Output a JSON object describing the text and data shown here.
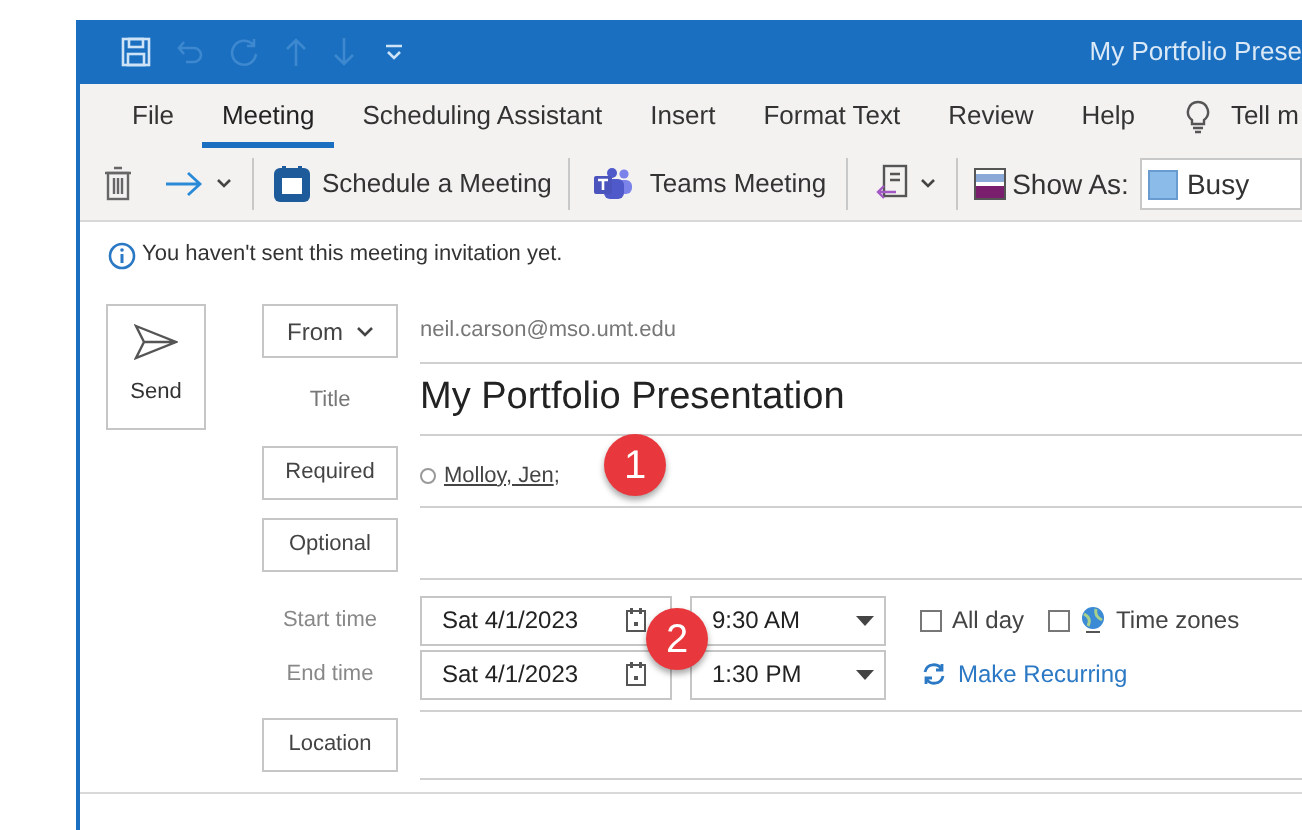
{
  "window": {
    "title": "My Portfolio Prese"
  },
  "tabs": [
    {
      "label": "File",
      "selected": false
    },
    {
      "label": "Meeting",
      "selected": true
    },
    {
      "label": "Scheduling Assistant",
      "selected": false
    },
    {
      "label": "Insert",
      "selected": false
    },
    {
      "label": "Format Text",
      "selected": false
    },
    {
      "label": "Review",
      "selected": false
    },
    {
      "label": "Help",
      "selected": false
    }
  ],
  "tell_me": "Tell m",
  "ribbon": {
    "schedule": "Schedule a Meeting",
    "teams": "Teams Meeting",
    "show_as_label": "Show As:",
    "show_as_value": "Busy"
  },
  "info_bar": "You haven't sent this meeting invitation yet.",
  "send": "Send",
  "from": {
    "label": "From",
    "value": "neil.carson@mso.umt.edu"
  },
  "title": {
    "label": "Title",
    "value": "My Portfolio Presentation"
  },
  "required": {
    "label": "Required",
    "attendee": "Molloy, Jen",
    "separator": ";"
  },
  "optional": {
    "label": "Optional"
  },
  "start": {
    "label": "Start time",
    "date": "Sat 4/1/2023",
    "time": "9:30 AM"
  },
  "end": {
    "label": "End time",
    "date": "Sat 4/1/2023",
    "time": "1:30 PM"
  },
  "all_day": {
    "label": "All day",
    "checked": false
  },
  "time_zones": {
    "label": "Time zones",
    "checked": false
  },
  "make_recurring": "Make Recurring",
  "location": {
    "label": "Location"
  },
  "callouts": [
    {
      "kind": "marker",
      "label": "1"
    },
    {
      "kind": "marker",
      "label": "2"
    }
  ]
}
